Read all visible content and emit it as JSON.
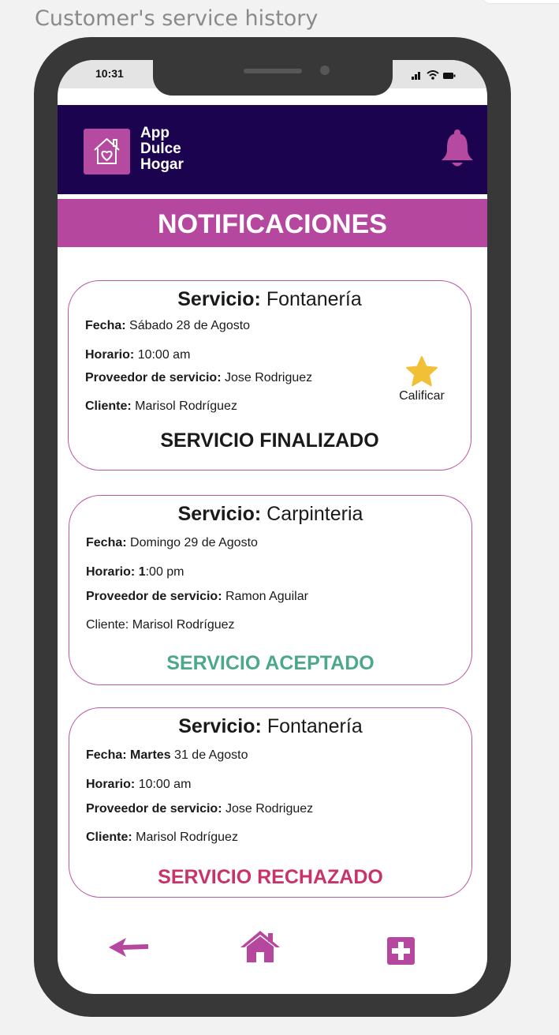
{
  "page_caption": "Customer's service history",
  "status_bar": {
    "time": "10:31"
  },
  "header": {
    "app_name_line1": "App",
    "app_name_line2": "Dulce",
    "app_name_line3": "Hogar",
    "logo_icon": "house-heart-icon",
    "bell_icon": "bell-icon"
  },
  "title": "NOTIFICACIONES",
  "labels": {
    "servicio": "Servicio:",
    "fecha": "Fecha:",
    "horario": "Horario:",
    "proveedor": "Proveedor de servicio:",
    "cliente": "Cliente:"
  },
  "cards": [
    {
      "service": "Fontanería",
      "date": "Sábado 28 de Agosto",
      "time": "10:00 am",
      "provider": "Jose Rodriguez",
      "client": "Marisol Rodríguez",
      "status": "SERVICIO FINALIZADO",
      "status_color": "#1a1a1a",
      "rate_label": "Calificar"
    },
    {
      "service": "Carpinteria",
      "date": "Domingo 29 de Agosto",
      "time_bold": "1",
      "time_rest": ":00 pm",
      "provider": "Ramon Aguilar",
      "client_full": "Cliente: Marisol Rodríguez",
      "status": "SERVICIO ACEPTADO",
      "status_color": "#4ca889"
    },
    {
      "service": "Fontanería",
      "date_label_bold": "Fecha: Martes",
      "date_rest": "31 de Agosto",
      "time": "10:00 am",
      "provider": "Jose Rodriguez",
      "client": "Marisol Rodríguez",
      "status": "SERVICIO RECHAZADO",
      "status_color": "#c8336a"
    }
  ],
  "bottom_nav": {
    "back_icon": "back-arrow-icon",
    "home_icon": "home-icon",
    "add_icon": "add-icon"
  },
  "colors": {
    "header_bg": "#1c0350",
    "accent": "#b6479e",
    "star": "#f2c037"
  }
}
